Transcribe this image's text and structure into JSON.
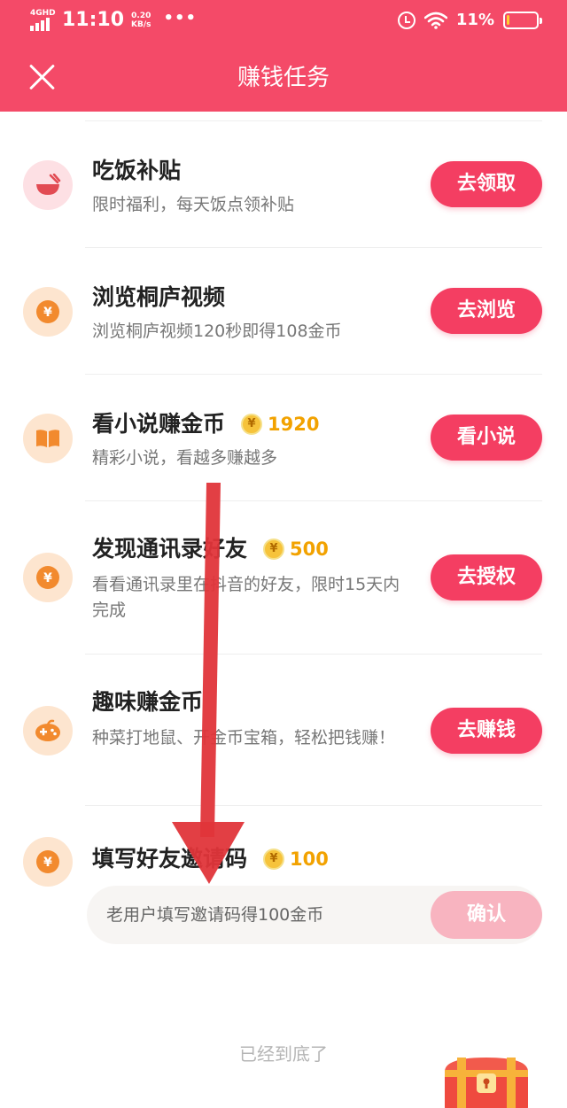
{
  "status_bar": {
    "network": "4GHD",
    "time": "11:10",
    "speed": "0.20",
    "speed_unit": "KB/s",
    "dots": "•••",
    "battery_percent": "11%",
    "battery_level": 0.11,
    "icons": [
      "signal-icon",
      "alarm-icon",
      "wifi-icon",
      "battery-icon"
    ]
  },
  "header": {
    "title": "赚钱任务",
    "close_icon": "close-icon",
    "bg_color": "#f44a68"
  },
  "tasks": [
    {
      "icon": "bowl-icon",
      "title": "吃饭补贴",
      "reward": "",
      "desc": "限时福利，每天饭点领补贴",
      "button": "去领取"
    },
    {
      "icon": "coin-icon",
      "title": "浏览桐庐视频",
      "reward": "",
      "desc": "浏览桐庐视频120秒即得108金币",
      "button": "去浏览"
    },
    {
      "icon": "book-icon",
      "title": "看小说赚金币",
      "reward": "1920",
      "desc": "精彩小说，看越多赚越多",
      "button": "看小说"
    },
    {
      "icon": "coin-icon",
      "title": "发现通讯录好友",
      "reward": "500",
      "desc": "看看通讯录里在抖音的好友，限时15天内完成",
      "button": "去授权"
    },
    {
      "icon": "game-icon",
      "title": "趣味赚金币",
      "reward": "",
      "desc": "种菜打地鼠、开金币宝箱，轻松把钱赚！",
      "button": "去赚钱"
    },
    {
      "icon": "coin-icon",
      "title": "填写好友邀请码",
      "reward": "100",
      "desc": "",
      "button": ""
    }
  ],
  "invite": {
    "placeholder": "老用户填写邀请码得100金币",
    "confirm": "确认"
  },
  "footer": {
    "note": "已经到底了"
  },
  "colors": {
    "accent": "#f43e62",
    "reward": "#f2a200",
    "arrow": "#e0353a"
  }
}
